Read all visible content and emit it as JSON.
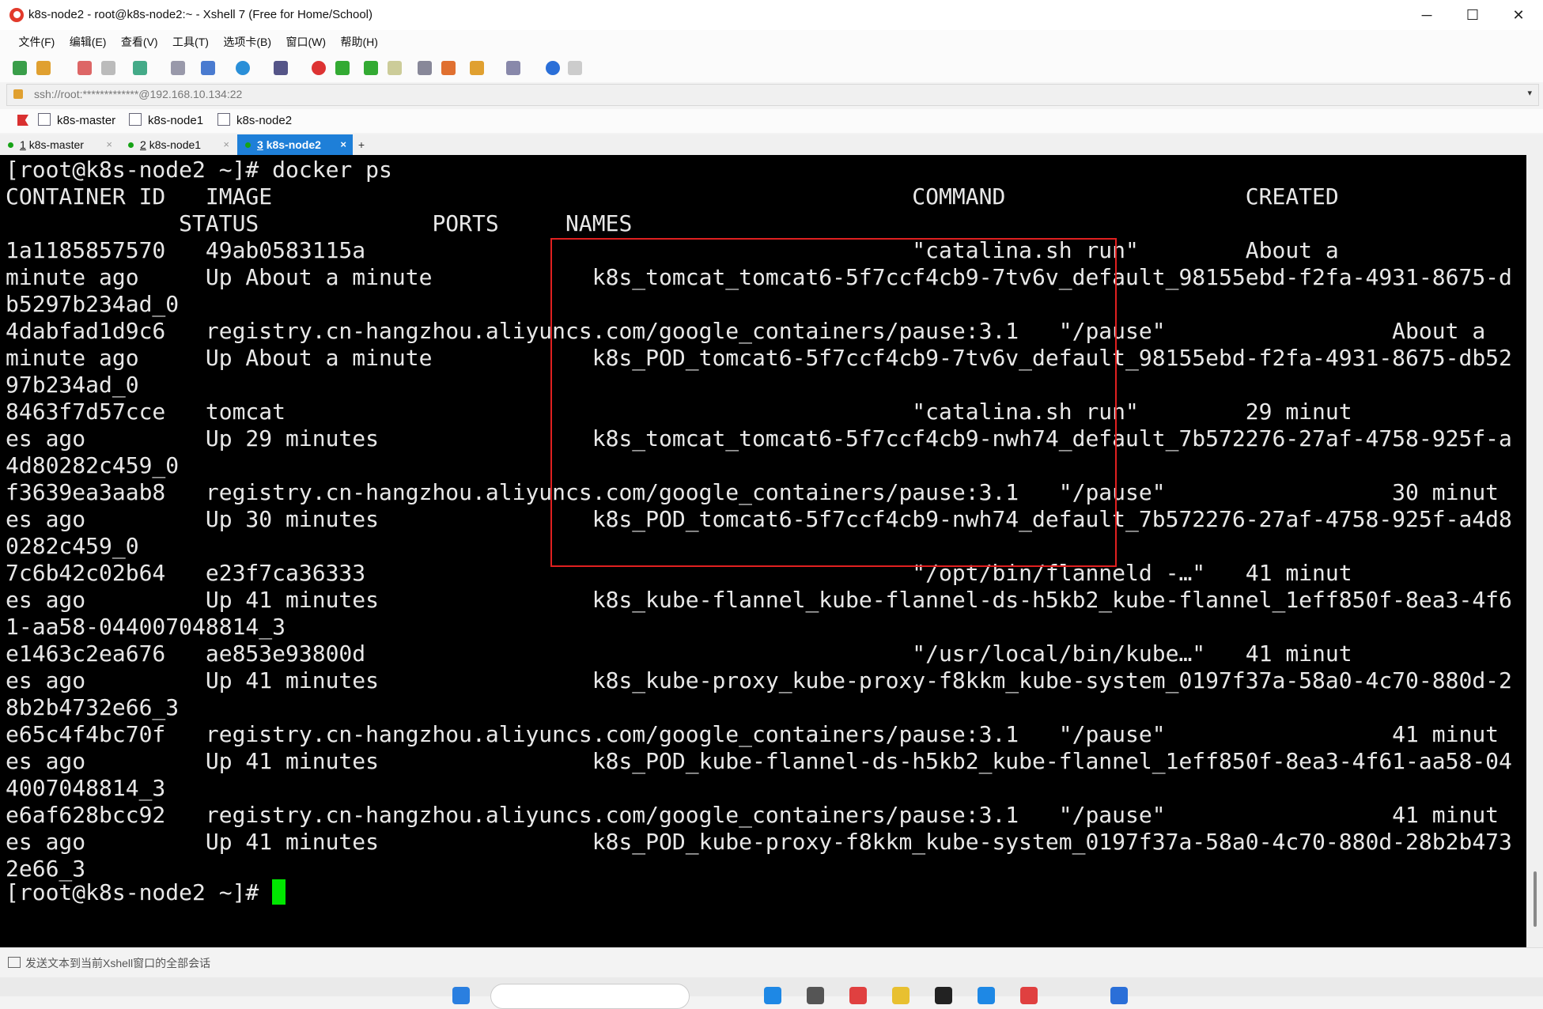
{
  "window": {
    "title": "k8s-node2 - root@k8s-node2:~ - Xshell 7 (Free for Home/School)",
    "minimize_glyph": "─",
    "maximize_glyph": "☐",
    "close_glyph": "✕"
  },
  "menu": [
    "文件(F)",
    "编辑(E)",
    "查看(V)",
    "工具(T)",
    "选项卡(B)",
    "窗口(W)",
    "帮助(H)"
  ],
  "address": {
    "value": "ssh://root:*************@192.168.10.134:22",
    "dropdown_glyph": "▾"
  },
  "links": [
    "k8s-master",
    "k8s-node1",
    "k8s-node2"
  ],
  "tabs": [
    {
      "num": "1",
      "label": "k8s-master",
      "close": "×"
    },
    {
      "num": "2",
      "label": "k8s-node1",
      "close": "×"
    },
    {
      "num": "3",
      "label": "k8s-node2",
      "close": "×"
    }
  ],
  "tab_add": "+",
  "terminal": {
    "lines": [
      "[root@k8s-node2 ~]# docker ps",
      "CONTAINER ID   IMAGE                                                COMMAND                  CREATED",
      "             STATUS             PORTS     NAMES",
      "1a1185857570   49ab0583115a                                         \"catalina.sh run\"        About a",
      "minute ago     Up About a minute            k8s_tomcat_tomcat6-5f7ccf4cb9-7tv6v_default_98155ebd-f2fa-4931-8675-d",
      "b5297b234ad_0",
      "4dabfad1d9c6   registry.cn-hangzhou.aliyuncs.com/google_containers/pause:3.1   \"/pause\"                 About a",
      "minute ago     Up About a minute            k8s_POD_tomcat6-5f7ccf4cb9-7tv6v_default_98155ebd-f2fa-4931-8675-db52",
      "97b234ad_0",
      "8463f7d57cce   tomcat                                               \"catalina.sh run\"        29 minut",
      "es ago         Up 29 minutes                k8s_tomcat_tomcat6-5f7ccf4cb9-nwh74_default_7b572276-27af-4758-925f-a",
      "4d80282c459_0",
      "f3639ea3aab8   registry.cn-hangzhou.aliyuncs.com/google_containers/pause:3.1   \"/pause\"                 30 minut",
      "es ago         Up 30 minutes                k8s_POD_tomcat6-5f7ccf4cb9-nwh74_default_7b572276-27af-4758-925f-a4d8",
      "0282c459_0",
      "7c6b42c02b64   e23f7ca36333                                         \"/opt/bin/flanneld -…\"   41 minut",
      "es ago         Up 41 minutes                k8s_kube-flannel_kube-flannel-ds-h5kb2_kube-flannel_1eff850f-8ea3-4f6",
      "1-aa58-044007048814_3",
      "e1463c2ea676   ae853e93800d                                         \"/usr/local/bin/kube…\"   41 minut",
      "es ago         Up 41 minutes                k8s_kube-proxy_kube-proxy-f8kkm_kube-system_0197f37a-58a0-4c70-880d-2",
      "8b2b4732e66_3",
      "e65c4f4bc70f   registry.cn-hangzhou.aliyuncs.com/google_containers/pause:3.1   \"/pause\"                 41 minut",
      "es ago         Up 41 minutes                k8s_POD_kube-flannel-ds-h5kb2_kube-flannel_1eff850f-8ea3-4f61-aa58-04",
      "4007048814_3",
      "e6af628bcc92   registry.cn-hangzhou.aliyuncs.com/google_containers/pause:3.1   \"/pause\"                 41 minut",
      "es ago         Up 41 minutes                k8s_POD_kube-proxy-f8kkm_kube-system_0197f37a-58a0-4c70-880d-28b2b473",
      "2e66_3"
    ],
    "prompt": "[root@k8s-node2 ~]# "
  },
  "status": {
    "text": "发送文本到当前Xshell窗口的全部会话"
  },
  "colors": {
    "tab_active": "#1e7fd8",
    "cursor": "#00e600",
    "highlight": "#e02020"
  }
}
